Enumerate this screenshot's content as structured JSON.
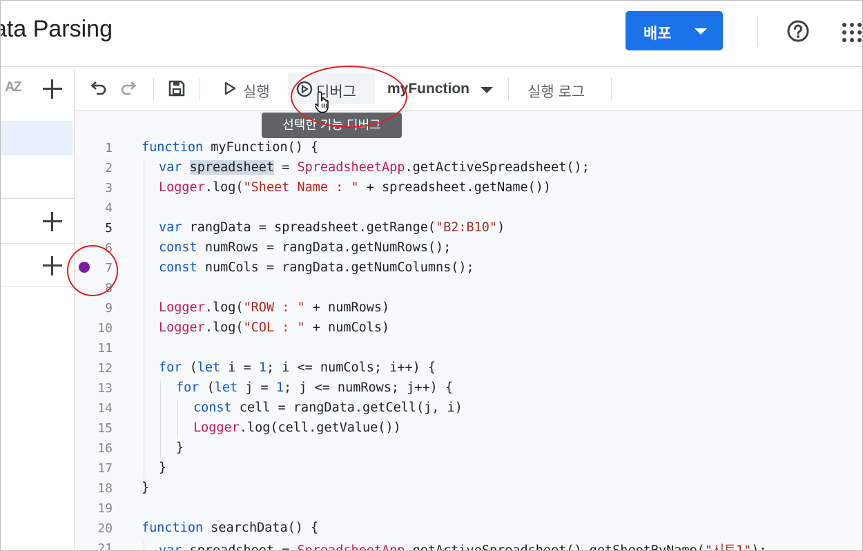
{
  "header": {
    "title": "ata Parsing",
    "deploy_label": "배포"
  },
  "toolbar": {
    "run_label": "실행",
    "debug_label": "디버그",
    "function_selected": "myFunction",
    "log_label": "실행 로그"
  },
  "tooltip": {
    "text": "선택한 기능 디버그"
  },
  "editor": {
    "line_numbers": [
      "1",
      "2",
      "3",
      "4",
      "5",
      "6",
      "7",
      "8",
      "9",
      "10",
      "11",
      "12",
      "13",
      "14",
      "15",
      "16",
      "17",
      "18",
      "19",
      "20",
      "21"
    ],
    "current_line": "5",
    "breakpoint_line": "7"
  },
  "colors": {
    "accent": "#1a73e8",
    "breakpoint": "#7b1fa2",
    "annotation": "#e0201b",
    "keyword": "#0b57d0",
    "class_name": "#c2185b",
    "string": "#b3261e"
  },
  "code": {
    "l1": [
      "function",
      "myFunction() {"
    ],
    "l2": [
      "var",
      "spreadsheet",
      "=",
      "SpreadsheetApp",
      ".getActiveSpreadsheet();"
    ],
    "l3": [
      "Logger",
      ".log(",
      "\"Sheet Name : \"",
      " + spreadsheet.getName())"
    ],
    "l5": [
      "var",
      "rangData = spreadsheet.getRange(",
      "\"B2:B10\"",
      ")"
    ],
    "l6": [
      "const",
      "numRows = rangData.getNumRows();"
    ],
    "l7": [
      "const",
      "numCols = rangData.getNumColumns();"
    ],
    "l9": [
      "Logger",
      ".log(",
      "\"ROW : \"",
      " + numRows)"
    ],
    "l10": [
      "Logger",
      ".log(",
      "\"COL : \"",
      " + numCols)"
    ],
    "l12": [
      "for",
      "(",
      "let",
      "i = ",
      "1",
      "; i <= numCols; i++) {"
    ],
    "l13": [
      "for",
      "(",
      "let",
      "j = ",
      "1",
      "; j <= numRows; j++) {"
    ],
    "l14": [
      "const",
      "cell = rangData.getCell(j, i)"
    ],
    "l15": [
      "Logger",
      ".log(cell.getValue())"
    ],
    "l16": "}",
    "l17": "}",
    "l18": "}",
    "l20": [
      "function",
      "searchData() {"
    ],
    "l21": [
      "var",
      "spreadsheet = ",
      "SpreadsheetApp",
      ".getActiveSpreadsheet().getSheetByName(",
      "\"시트1\"",
      ");"
    ]
  }
}
